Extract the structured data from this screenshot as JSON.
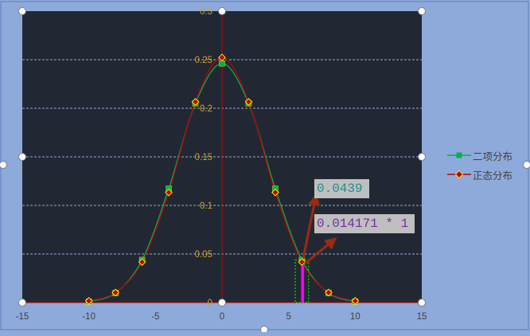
{
  "chart_data": {
    "type": "scatter",
    "series": [
      {
        "name": "二项分布",
        "color": "#00b050",
        "marker": "square",
        "x": [
          -10,
          -8,
          -6,
          -4,
          -2,
          0,
          2,
          4,
          6,
          8,
          10
        ],
        "y": [
          0.001,
          0.0098,
          0.0439,
          0.1172,
          0.2051,
          0.2461,
          0.2051,
          0.1172,
          0.0439,
          0.0098,
          0.001
        ]
      },
      {
        "name": "正态分布",
        "color": "#c00000",
        "marker": "diamond",
        "x": [
          -10,
          -8,
          -6,
          -4,
          -2,
          0,
          2,
          4,
          6,
          8,
          10
        ],
        "y": [
          0.0017,
          0.0103,
          0.0417,
          0.1134,
          0.2066,
          0.2523,
          0.2066,
          0.1134,
          0.0417,
          0.0103,
          0.0017
        ]
      }
    ],
    "xlim": [
      -15,
      15
    ],
    "ylim": [
      0,
      0.3
    ],
    "xticks": [
      "-15",
      "-10",
      "-5",
      "0",
      "5",
      "10",
      "15"
    ],
    "yticks": [
      "0",
      "0.05",
      "0.1",
      "0.15",
      "0.2",
      "0.25",
      "0.3"
    ],
    "grid": "horizontal dashed",
    "legend_position": "right",
    "plot_background": "#222833",
    "annotations": [
      {
        "text": "0.0439",
        "color": "#1f8f8f",
        "points_to_x": 6,
        "points_to_y": 0.0439
      },
      {
        "text": "0.014171 * 1",
        "color": "#7030a0",
        "points_to_x": 6,
        "points_to_y": 0.0417
      }
    ],
    "highlight": {
      "x_from": 5.5,
      "x_to": 6.5,
      "outline_color": "#00e000",
      "bar_color": "#ff00ff",
      "bar_x": 6.05
    }
  }
}
